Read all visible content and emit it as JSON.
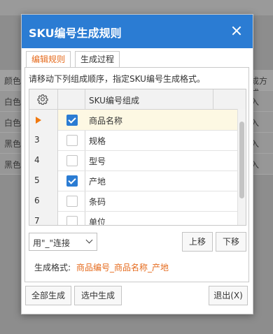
{
  "background": {
    "header_cells": [
      "颜色",
      "成方式"
    ],
    "rows": [
      {
        "left": "白色",
        "right": "入"
      },
      {
        "left": "白色",
        "right": "入"
      },
      {
        "left": "黑色",
        "right": "入"
      },
      {
        "left": "黑色",
        "right": "入"
      }
    ]
  },
  "dialog": {
    "title": "SKU编号生成规则",
    "tabs": [
      {
        "label": "编辑规则",
        "active": true
      },
      {
        "label": "生成过程",
        "active": false
      }
    ],
    "instruction": "请移动下列组成顺序，指定SKU编号生成格式。",
    "grid": {
      "header_icon": "gear-icon",
      "column_header": "SKU编号组成",
      "rows": [
        {
          "num": "",
          "current": true,
          "checked": true,
          "label": "商品名称"
        },
        {
          "num": "3",
          "current": false,
          "checked": false,
          "label": "规格"
        },
        {
          "num": "4",
          "current": false,
          "checked": false,
          "label": "型号"
        },
        {
          "num": "5",
          "current": false,
          "checked": true,
          "label": "产地"
        },
        {
          "num": "6",
          "current": false,
          "checked": false,
          "label": "条码"
        },
        {
          "num": "7",
          "current": false,
          "checked": false,
          "label": "单位"
        }
      ]
    },
    "connector_select": {
      "selected": "用\"_\"连接"
    },
    "move_up_label": "上移",
    "move_down_label": "下移",
    "format_label": "生成格式:",
    "format_value": "商品编号_商品名称_产地",
    "generate_all_label": "全部生成",
    "generate_selected_label": "选中生成",
    "exit_label": "退出(X)"
  },
  "colors": {
    "header_blue": "#2b7cd3",
    "accent_orange": "#e56a1c",
    "selected_row": "#fdf8e3"
  }
}
